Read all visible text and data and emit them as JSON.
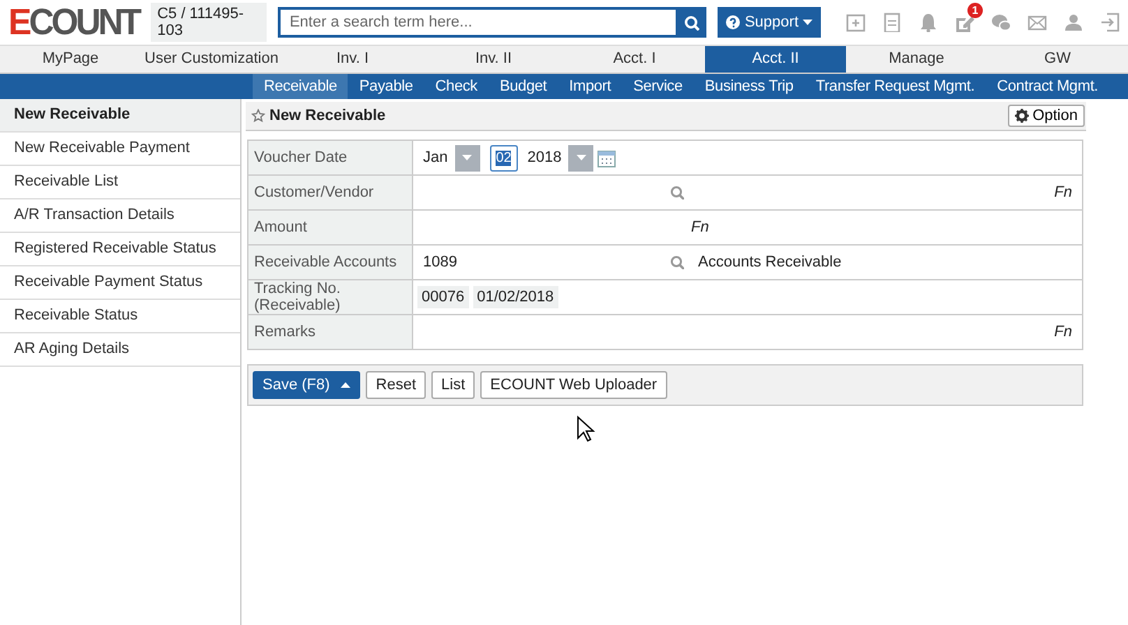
{
  "header": {
    "logo": "ECOUNT",
    "company": "C5 / 111495-103",
    "search": {
      "placeholder": "Enter a search term here..."
    },
    "support": "Support",
    "notification_badge": "1"
  },
  "main_tabs": [
    {
      "label": "MyPage",
      "selected": false
    },
    {
      "label": "User Customization",
      "selected": false
    },
    {
      "label": "Inv. I",
      "selected": false
    },
    {
      "label": "Inv. II",
      "selected": false
    },
    {
      "label": "Acct. I",
      "selected": false
    },
    {
      "label": "Acct. II",
      "selected": true
    },
    {
      "label": "Manage",
      "selected": false
    },
    {
      "label": "GW",
      "selected": false
    }
  ],
  "sub_tabs": [
    {
      "label": "Receivable",
      "selected": true
    },
    {
      "label": "Payable",
      "selected": false
    },
    {
      "label": "Check",
      "selected": false
    },
    {
      "label": "Budget",
      "selected": false
    },
    {
      "label": "Import",
      "selected": false
    },
    {
      "label": "Service",
      "selected": false
    },
    {
      "label": "Business Trip",
      "selected": false
    },
    {
      "label": "Transfer Request Mgmt.",
      "selected": false
    },
    {
      "label": "Contract Mgmt.",
      "selected": false
    }
  ],
  "sidebar": {
    "items": [
      {
        "label": "New Receivable",
        "selected": true
      },
      {
        "label": "New Receivable Payment",
        "selected": false
      },
      {
        "label": "Receivable List",
        "selected": false
      },
      {
        "label": "A/R Transaction Details",
        "selected": false
      },
      {
        "label": "Registered Receivable Status",
        "selected": false
      },
      {
        "label": "Receivable Payment Status",
        "selected": false
      },
      {
        "label": "Receivable Status",
        "selected": false
      },
      {
        "label": "AR Aging Details",
        "selected": false
      }
    ]
  },
  "page": {
    "title": "New Receivable",
    "option_button": "Option"
  },
  "form": {
    "rows": [
      {
        "kind": "date",
        "label": "Voucher Date",
        "month": "Jan",
        "day": "02",
        "year": "2018"
      },
      {
        "kind": "lookup",
        "label": "Customer/Vendor",
        "fn": "Fn"
      },
      {
        "kind": "amount",
        "label": "Amount",
        "fn": "Fn"
      },
      {
        "kind": "lookup",
        "label": "Receivable Accounts",
        "code": "1089",
        "name": "Accounts Receivable"
      },
      {
        "kind": "tracking",
        "label": "Tracking No. (Receivable)",
        "chips": [
          "00076",
          "01/02/2018"
        ]
      },
      {
        "kind": "text",
        "label": "Remarks",
        "fn": "Fn"
      }
    ]
  },
  "buttons": [
    {
      "label": "Save (F8)",
      "kind": "primary"
    },
    {
      "label": "Reset",
      "kind": "plain"
    },
    {
      "label": "List",
      "kind": "plain"
    },
    {
      "label": "ECOUNT Web Uploader",
      "kind": "plain"
    }
  ]
}
